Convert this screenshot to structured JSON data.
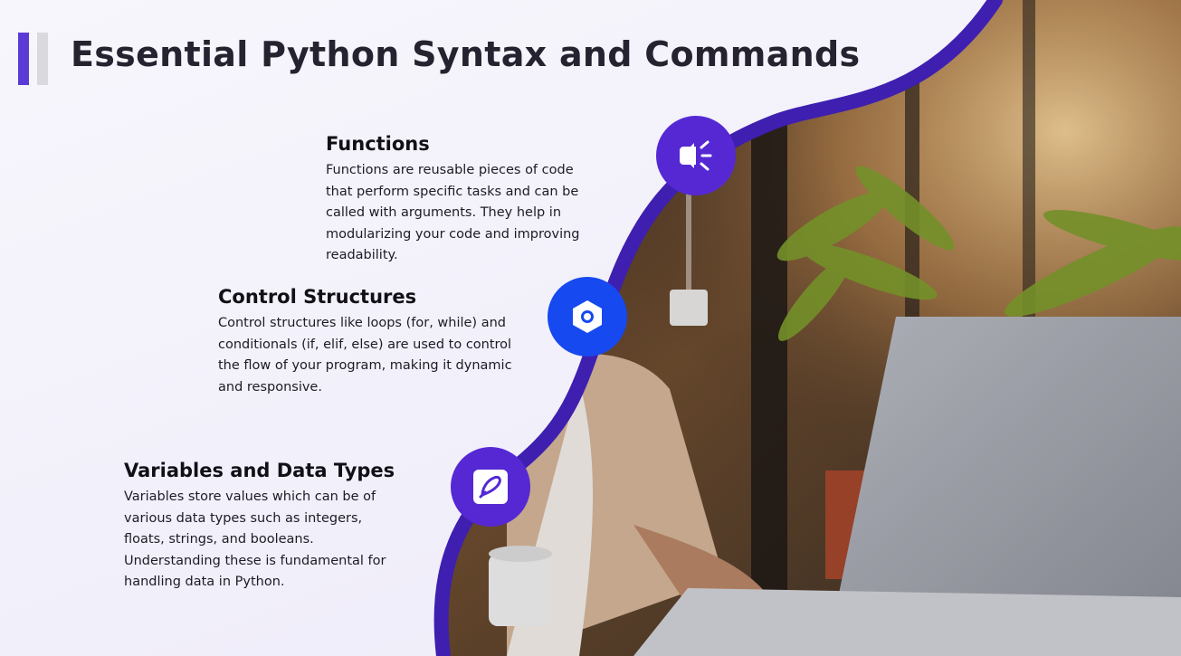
{
  "title": "Essential Python Syntax and Commands",
  "accent_colors": {
    "primary": "#5528d3",
    "secondary": "#1749f0",
    "bar_gray": "#d9d9de"
  },
  "items": [
    {
      "heading": "Functions",
      "body": "Functions are reusable pieces of code that perform specific tasks and can be called with arguments. They help in modularizing your code and improving readability.",
      "icon": "megaphone-icon"
    },
    {
      "heading": "Control Structures",
      "body": "Control structures like loops (for, while) and conditionals (if, elif, else) are used to control the flow of your program, making it dynamic and responsive.",
      "icon": "hexagon-nut-icon"
    },
    {
      "heading": "Variables and Data Types",
      "body": "Variables store values which can be of various data types such as integers, floats, strings, and booleans. Understanding these is fundamental for handling data in Python.",
      "icon": "pencil-edit-icon"
    }
  ]
}
